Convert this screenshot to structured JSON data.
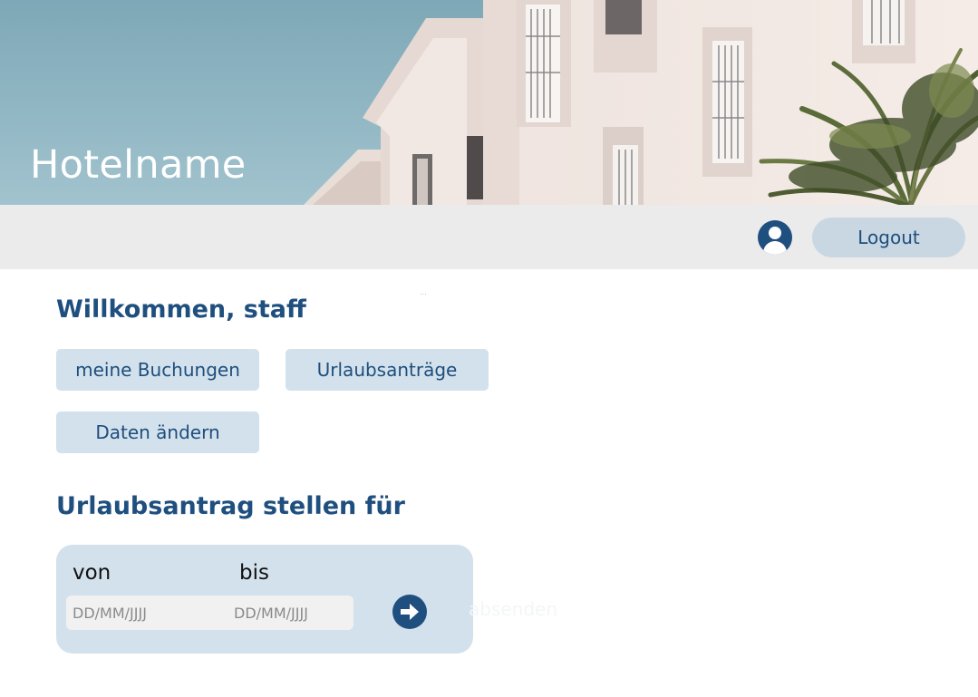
{
  "hero": {
    "title": "Hotelname"
  },
  "topbar": {
    "avatar_icon": "user-circle-icon",
    "logout_label": "Logout"
  },
  "main": {
    "decoration_text": "...",
    "welcome": "Willkommen, staff",
    "nav": [
      {
        "label": "meine Buchungen"
      },
      {
        "label": "Urlaubsanträge"
      },
      {
        "label": "Daten ändern"
      }
    ],
    "request": {
      "title": "Urlaubsantrag stellen für",
      "from_label": "von",
      "to_label": "bis",
      "from_placeholder": "DD/MM/JJJJ",
      "to_placeholder": "DD/MM/JJJJ",
      "submit_icon": "arrow-right-circle-icon",
      "faint_text": "absenden"
    }
  },
  "colors": {
    "primary": "#1f4f7f",
    "button_bg": "#d3e1ec",
    "topbar_bg": "#ebebeb",
    "card_bg": "#d3e1ec",
    "sky": "#8fb6c4"
  }
}
